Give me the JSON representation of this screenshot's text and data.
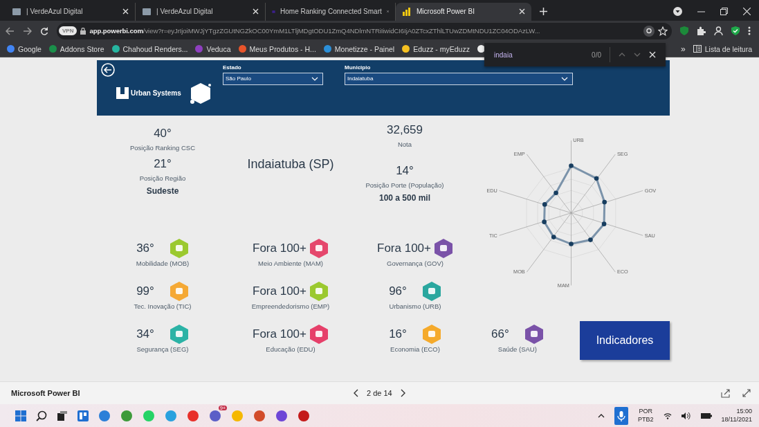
{
  "browser": {
    "tabs": [
      {
        "title": "| VerdeAzul Digital",
        "selected": false
      },
      {
        "title": "| VerdeAzul Digital",
        "selected": false
      },
      {
        "title": "Home Ranking Connected Smart",
        "selected": false
      },
      {
        "title": "Microsoft Power BI",
        "selected": true
      }
    ],
    "vpn": "VPN",
    "url_host": "app.powerbi.com",
    "url_path": "/view?r=eyJrIjoiMWJjYTgzZGUtNGZkOC00YmM1LTljMDgtODU1ZmQ4NDlmNTRiIiwidCI6IjA0ZTcxZThlLTUwZDMtNDU1ZC04ODAzLW...",
    "bookmarks": [
      "Google",
      "Addons Store",
      "Chahoud Renders...",
      "Veduca",
      "Meus Produtos - H...",
      "Monetizze - Painel",
      "Eduzz - myEduzz"
    ],
    "bookmarks_more": "»",
    "reading_list": "Lista de leitura",
    "find": {
      "value": "indaia",
      "count": "0/0"
    }
  },
  "report": {
    "filters": [
      {
        "label": "Estado",
        "value": "São Paulo"
      },
      {
        "label": "Municipio",
        "value": "Indaiatuba"
      }
    ],
    "logo_text": "Urban Systems",
    "ranking": {
      "value": "40°",
      "label": "Posição Ranking CSC"
    },
    "region": {
      "value": "21°",
      "label": "Posição Região",
      "name": "Sudeste"
    },
    "city": "Indaiatuba (SP)",
    "score": {
      "value": "32,659",
      "label": "Nota"
    },
    "size": {
      "value": "14°",
      "label": "Posição Porte (População)",
      "range": "100 a 500 mil"
    },
    "radar_axes": [
      "URB",
      "SEG",
      "GOV",
      "SAU",
      "ECO",
      "MAM",
      "MOB",
      "TIC",
      "EDU",
      "EMP"
    ],
    "indicators": [
      {
        "value": "36°",
        "label": "Mobilidade (MOB)",
        "color": "#9bc92f"
      },
      {
        "value": "Fora 100+",
        "label": "Meio Ambiente (MAM)",
        "color": "#e5476c"
      },
      {
        "value": "Fora 100+",
        "label": "Governança (GOV)",
        "color": "#7a52a8"
      },
      {
        "value": "99°",
        "label": "Tec. Inovação (TIC)",
        "color": "#f5a935"
      },
      {
        "value": "Fora 100+",
        "label": "Empreendedorismo (EMP)",
        "color": "#9bc92f"
      },
      {
        "value": "96°",
        "label": "Urbanismo (URB)",
        "color": "#2aa79f"
      },
      {
        "value": "34°",
        "label": "Segurança (SEG)",
        "color": "#2bb3a6"
      },
      {
        "value": "Fora 100+",
        "label": "Educação (EDU)",
        "color": "#e6406a"
      },
      {
        "value": "16°",
        "label": "Economia (ECO)",
        "color": "#f5aa2b"
      },
      {
        "value": "66°",
        "label": "Saúde (SAU)",
        "color": "#7a52a8"
      }
    ],
    "button": "Indicadores"
  },
  "footer": {
    "title": "Microsoft Power BI",
    "page": "2 de 14"
  },
  "taskbar": {
    "badge": "9+",
    "lang": "POR",
    "layout": "PTB2",
    "time": "15:00",
    "date": "18/11/2021"
  }
}
